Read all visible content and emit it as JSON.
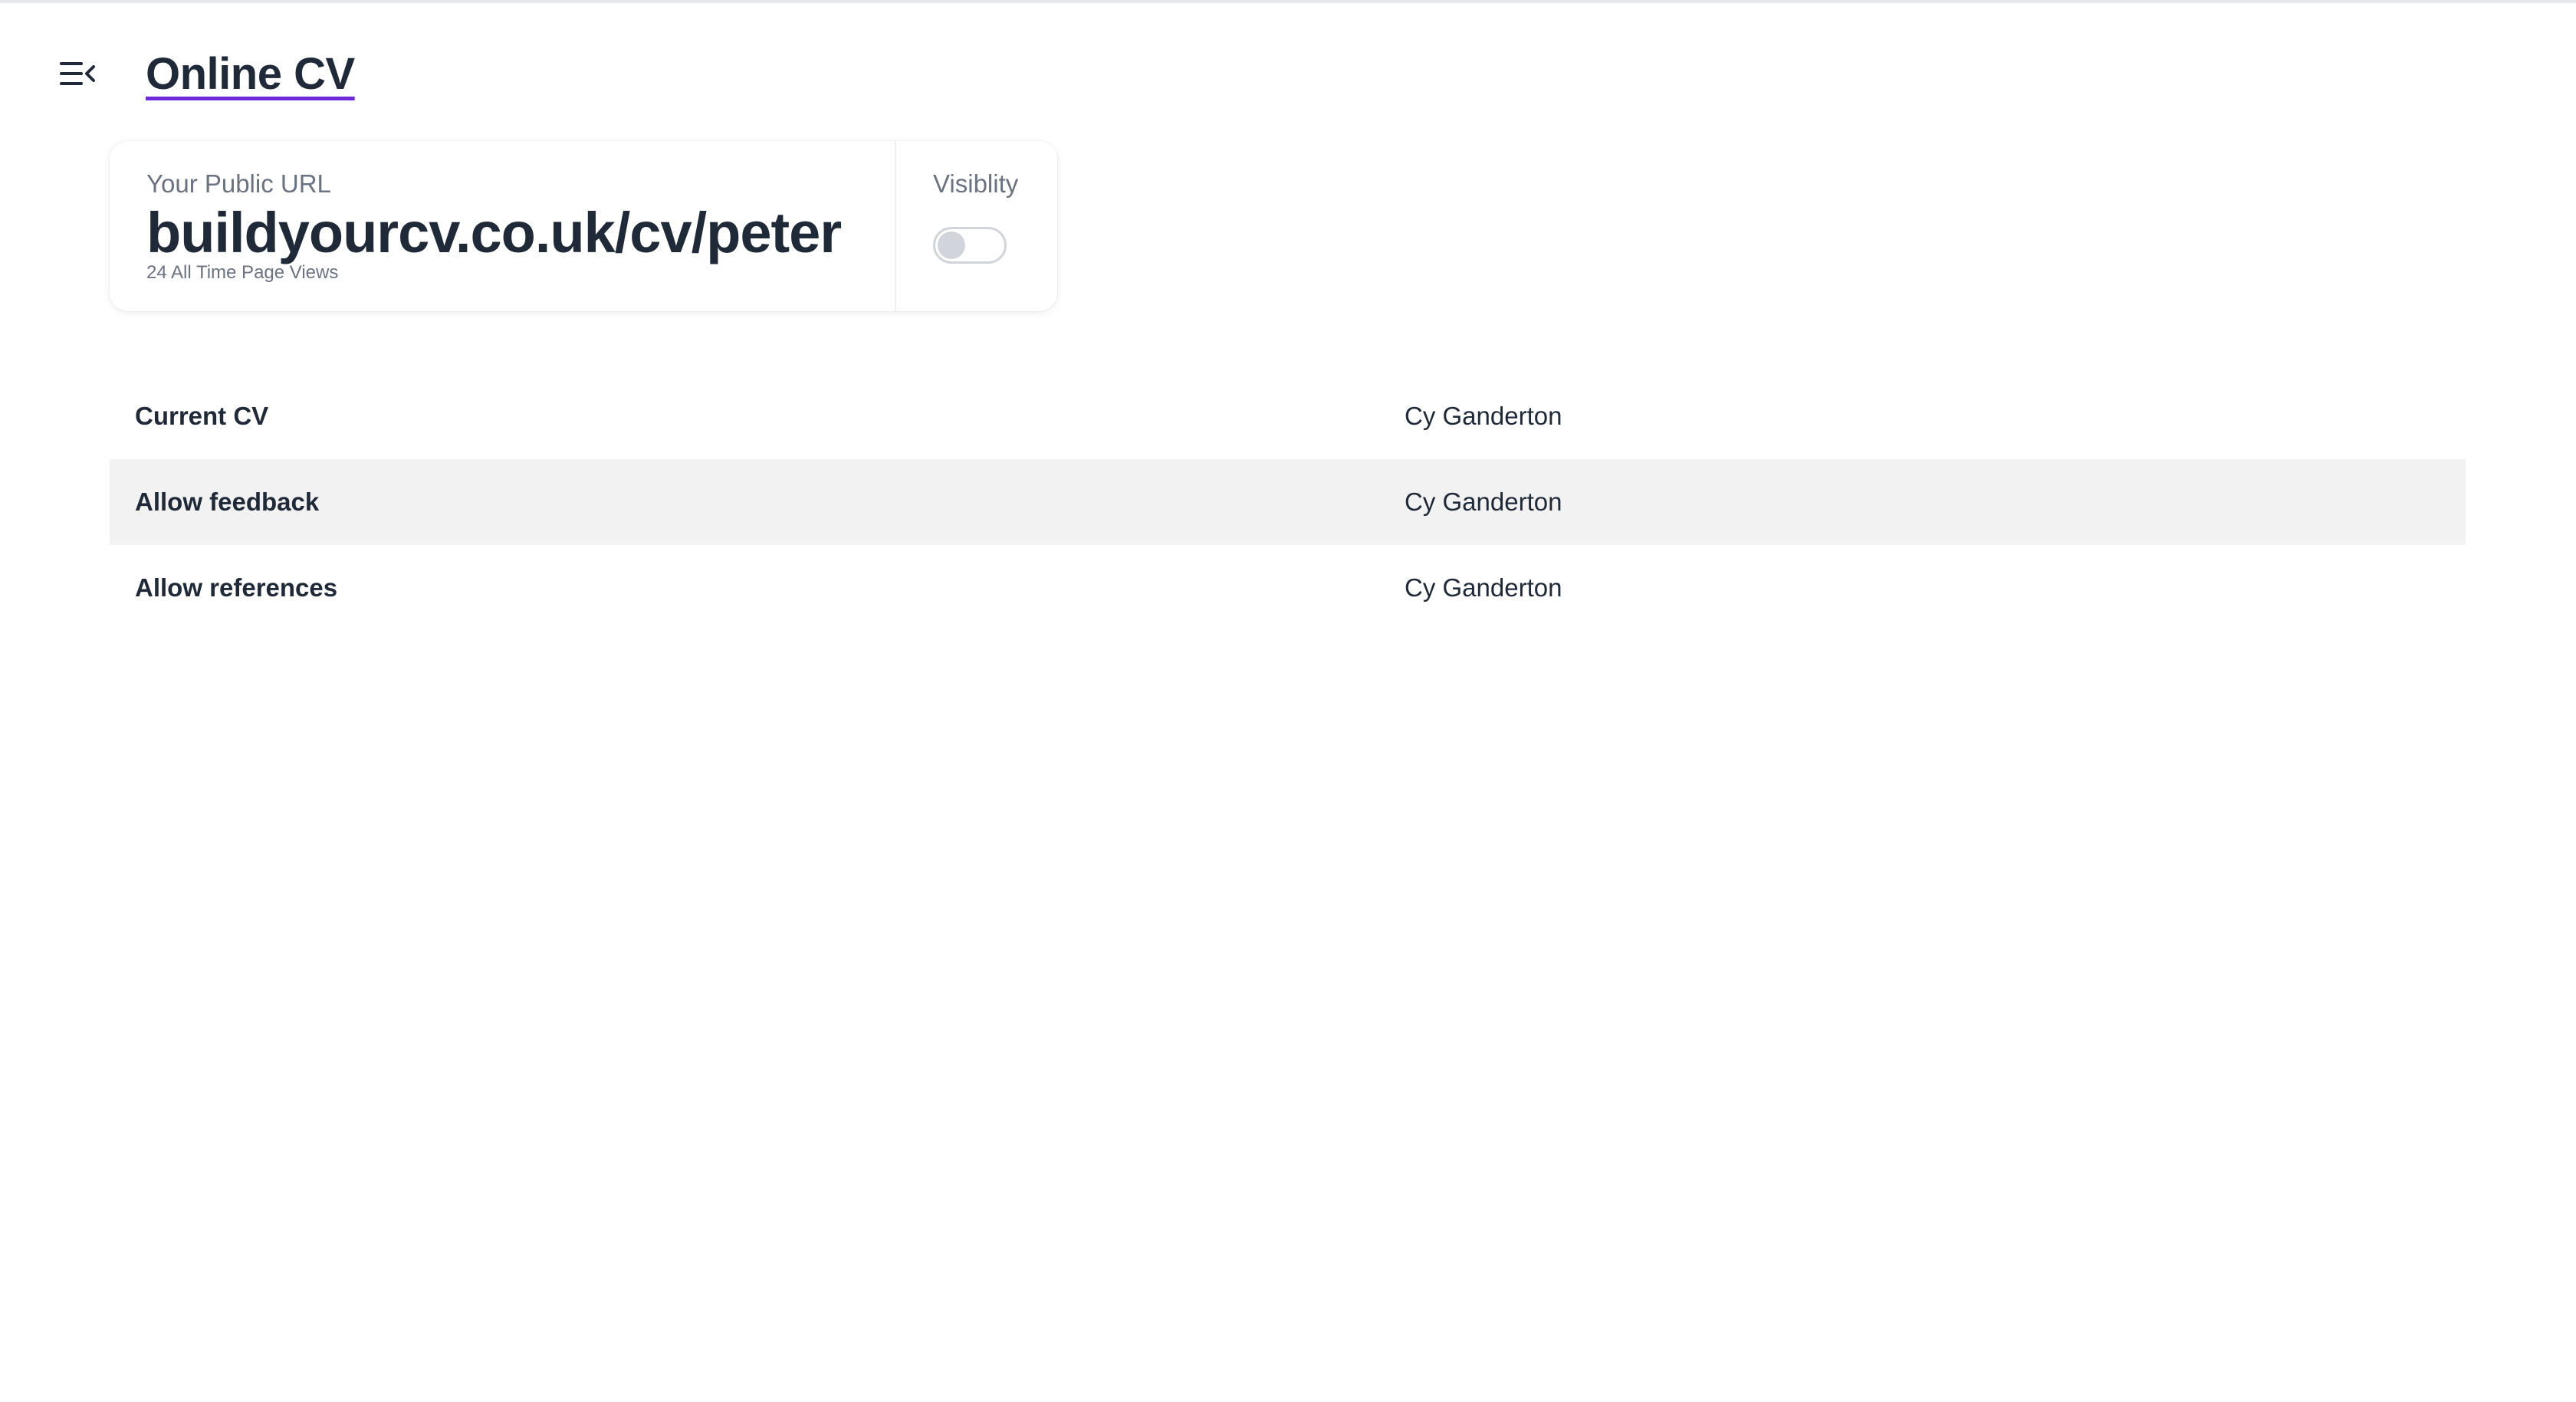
{
  "header": {
    "menu_icon": "menu-collapse-icon",
    "title": "Online CV"
  },
  "url_card": {
    "label": "Your Public URL",
    "url": "buildyourcv.co.uk/cv/peter",
    "views": "24 All Time Page Views",
    "visibility_label": "Visiblity",
    "visibility_on": false
  },
  "settings": {
    "rows": [
      {
        "label": "Current CV",
        "value": "Cy Ganderton"
      },
      {
        "label": "Allow feedback",
        "value": "Cy Ganderton"
      },
      {
        "label": "Allow references",
        "value": "Cy Ganderton"
      }
    ]
  },
  "colors": {
    "title_underline": "#6d28d9",
    "text": "#1f2937",
    "muted": "#6b7280",
    "row_alt": "#f2f2f2"
  }
}
